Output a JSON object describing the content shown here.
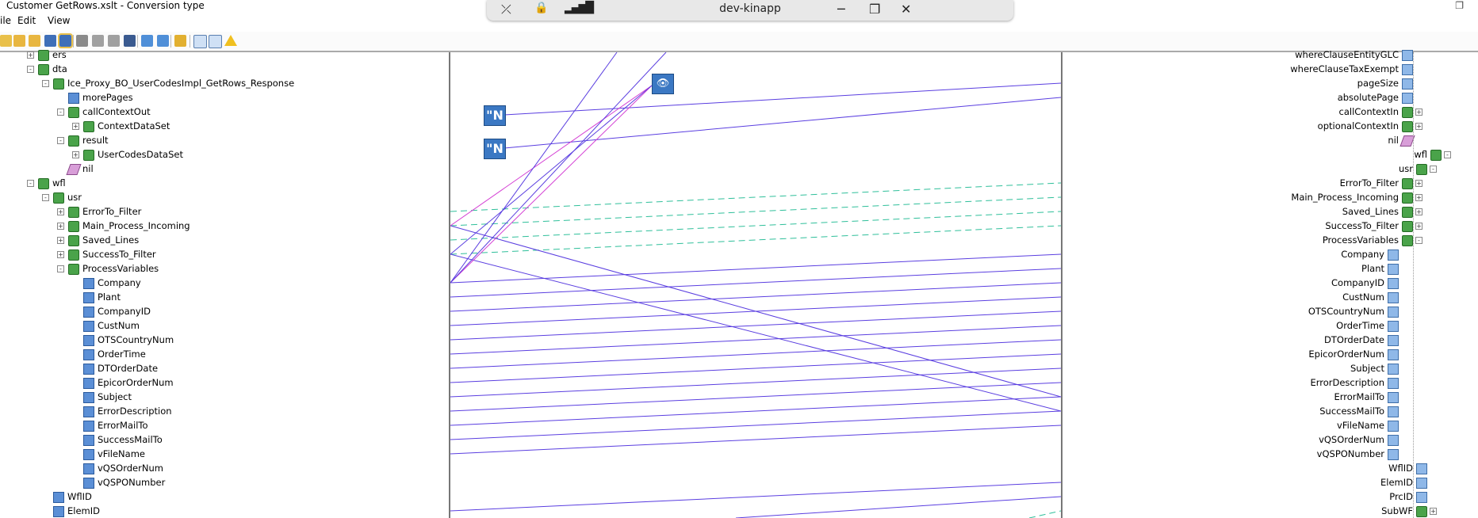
{
  "window": {
    "title": "Customer GetRows.xslt - Conversion type",
    "restore_glyph": "❐"
  },
  "menu": [
    "ile",
    "Edit",
    "View"
  ],
  "remote_bar": {
    "host": "dev-kinapp"
  },
  "left_tree": [
    {
      "label": "ers",
      "depth": 2,
      "kind": "group",
      "exp": "+"
    },
    {
      "label": "dta",
      "depth": 2,
      "kind": "group",
      "exp": "-"
    },
    {
      "label": "Ice_Proxy_BO_UserCodesImpl_GetRows_Response",
      "depth": 3,
      "kind": "group",
      "exp": "-"
    },
    {
      "label": "morePages",
      "depth": 4,
      "kind": "field",
      "exp": ""
    },
    {
      "label": "callContextOut",
      "depth": 4,
      "kind": "group",
      "exp": "-"
    },
    {
      "label": "ContextDataSet",
      "depth": 5,
      "kind": "group",
      "exp": "+"
    },
    {
      "label": "result",
      "depth": 4,
      "kind": "group",
      "exp": "-"
    },
    {
      "label": "UserCodesDataSet",
      "depth": 5,
      "kind": "group",
      "exp": "+"
    },
    {
      "label": "nil",
      "depth": 4,
      "kind": "nil",
      "exp": ""
    },
    {
      "label": "wfl",
      "depth": 2,
      "kind": "group",
      "exp": "-"
    },
    {
      "label": "usr",
      "depth": 3,
      "kind": "group",
      "exp": "-"
    },
    {
      "label": "ErrorTo_Filter",
      "depth": 4,
      "kind": "group",
      "exp": "+"
    },
    {
      "label": "Main_Process_Incoming",
      "depth": 4,
      "kind": "group",
      "exp": "+"
    },
    {
      "label": "Saved_Lines",
      "depth": 4,
      "kind": "group",
      "exp": "+"
    },
    {
      "label": "SuccessTo_Filter",
      "depth": 4,
      "kind": "group",
      "exp": "+"
    },
    {
      "label": "ProcessVariables",
      "depth": 4,
      "kind": "group",
      "exp": "-"
    },
    {
      "label": "Company",
      "depth": 5,
      "kind": "field",
      "exp": ""
    },
    {
      "label": "Plant",
      "depth": 5,
      "kind": "field",
      "exp": ""
    },
    {
      "label": "CompanyID",
      "depth": 5,
      "kind": "field",
      "exp": ""
    },
    {
      "label": "CustNum",
      "depth": 5,
      "kind": "field",
      "exp": ""
    },
    {
      "label": "OTSCountryNum",
      "depth": 5,
      "kind": "field",
      "exp": ""
    },
    {
      "label": "OrderTime",
      "depth": 5,
      "kind": "field",
      "exp": ""
    },
    {
      "label": "DTOrderDate",
      "depth": 5,
      "kind": "field",
      "exp": ""
    },
    {
      "label": "EpicorOrderNum",
      "depth": 5,
      "kind": "field",
      "exp": ""
    },
    {
      "label": "Subject",
      "depth": 5,
      "kind": "field",
      "exp": ""
    },
    {
      "label": "ErrorDescription",
      "depth": 5,
      "kind": "field",
      "exp": ""
    },
    {
      "label": "ErrorMailTo",
      "depth": 5,
      "kind": "field",
      "exp": ""
    },
    {
      "label": "SuccessMailTo",
      "depth": 5,
      "kind": "field",
      "exp": ""
    },
    {
      "label": "vFileName",
      "depth": 5,
      "kind": "field",
      "exp": ""
    },
    {
      "label": "vQSOrderNum",
      "depth": 5,
      "kind": "field",
      "exp": ""
    },
    {
      "label": "vQSPONumber",
      "depth": 5,
      "kind": "field",
      "exp": ""
    },
    {
      "label": "WflID",
      "depth": 3,
      "kind": "field",
      "exp": ""
    },
    {
      "label": "ElemID",
      "depth": 3,
      "kind": "field",
      "exp": ""
    }
  ],
  "right_tree": [
    {
      "label": "whereClauseEntityGLC",
      "col": 0,
      "kind": "rfield",
      "exp": ""
    },
    {
      "label": "whereClauseTaxExempt",
      "col": 0,
      "kind": "rfield",
      "exp": ""
    },
    {
      "label": "pageSize",
      "col": 0,
      "kind": "rfield",
      "exp": ""
    },
    {
      "label": "absolutePage",
      "col": 0,
      "kind": "rfield",
      "exp": ""
    },
    {
      "label": "callContextIn",
      "col": 0,
      "kind": "group",
      "exp": "+"
    },
    {
      "label": "optionalContextIn",
      "col": 0,
      "kind": "group",
      "exp": "+"
    },
    {
      "label": "nil",
      "col": 0,
      "kind": "nil",
      "exp": ""
    },
    {
      "label": "wfl",
      "col": -2,
      "kind": "group",
      "exp": "-"
    },
    {
      "label": "usr",
      "col": -1,
      "kind": "group",
      "exp": "-"
    },
    {
      "label": "ErrorTo_Filter",
      "col": 0,
      "kind": "group",
      "exp": "+"
    },
    {
      "label": "Main_Process_Incoming",
      "col": 0,
      "kind": "group",
      "exp": "+"
    },
    {
      "label": "Saved_Lines",
      "col": 0,
      "kind": "group",
      "exp": "+"
    },
    {
      "label": "SuccessTo_Filter",
      "col": 0,
      "kind": "group",
      "exp": "+"
    },
    {
      "label": "ProcessVariables",
      "col": 0,
      "kind": "group",
      "exp": "-"
    },
    {
      "label": "Company",
      "col": 1,
      "kind": "rfield",
      "exp": ""
    },
    {
      "label": "Plant",
      "col": 1,
      "kind": "rfield",
      "exp": ""
    },
    {
      "label": "CompanyID",
      "col": 1,
      "kind": "rfield",
      "exp": ""
    },
    {
      "label": "CustNum",
      "col": 1,
      "kind": "rfield",
      "exp": ""
    },
    {
      "label": "OTSCountryNum",
      "col": 1,
      "kind": "rfield",
      "exp": ""
    },
    {
      "label": "OrderTime",
      "col": 1,
      "kind": "rfield",
      "exp": ""
    },
    {
      "label": "DTOrderDate",
      "col": 1,
      "kind": "rfield",
      "exp": ""
    },
    {
      "label": "EpicorOrderNum",
      "col": 1,
      "kind": "rfield",
      "exp": ""
    },
    {
      "label": "Subject",
      "col": 1,
      "kind": "rfield",
      "exp": ""
    },
    {
      "label": "ErrorDescription",
      "col": 1,
      "kind": "rfield",
      "exp": ""
    },
    {
      "label": "ErrorMailTo",
      "col": 1,
      "kind": "rfield",
      "exp": ""
    },
    {
      "label": "SuccessMailTo",
      "col": 1,
      "kind": "rfield",
      "exp": ""
    },
    {
      "label": "vFileName",
      "col": 1,
      "kind": "rfield",
      "exp": ""
    },
    {
      "label": "vQSOrderNum",
      "col": 1,
      "kind": "rfield",
      "exp": ""
    },
    {
      "label": "vQSPONumber",
      "col": 1,
      "kind": "rfield",
      "exp": ""
    },
    {
      "label": "WflID",
      "col": -1,
      "kind": "rfield",
      "exp": ""
    },
    {
      "label": "ElemID",
      "col": -1,
      "kind": "rfield",
      "exp": ""
    },
    {
      "label": "PrcID",
      "col": -1,
      "kind": "rfield",
      "exp": ""
    },
    {
      "label": "SubWF",
      "col": -1,
      "kind": "group",
      "exp": "+"
    }
  ],
  "functoids": [
    {
      "label": "\"N",
      "type": "string-constant"
    },
    {
      "label": "\"N",
      "type": "string-constant"
    },
    {
      "label": "👁",
      "type": "value-mapping"
    }
  ],
  "colors": {
    "link": "#5a3ee0",
    "link_pink": "#d43fd4",
    "link_dashed": "#2fbf9a",
    "accent": "#3b78c3"
  }
}
